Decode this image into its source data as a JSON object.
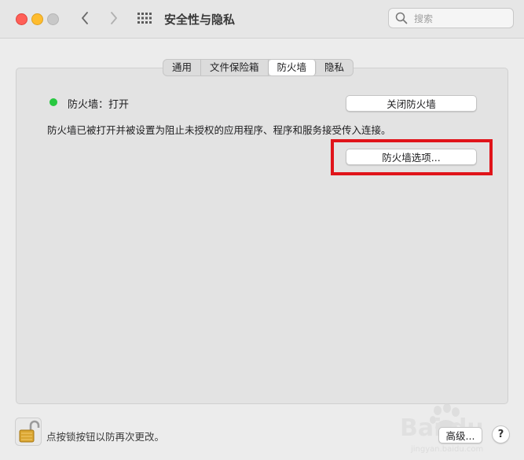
{
  "window": {
    "title": "安全性与隐私"
  },
  "search": {
    "placeholder": "搜索",
    "value": ""
  },
  "tabs": [
    {
      "label": "通用",
      "selected": false
    },
    {
      "label": "文件保险箱",
      "selected": false
    },
    {
      "label": "防火墙",
      "selected": true
    },
    {
      "label": "隐私",
      "selected": false
    }
  ],
  "firewall": {
    "status_label": "防火墙：打开",
    "status_color": "#28c840",
    "toggle_button_label": "关闭防火墙",
    "description": "防火墙已被打开并被设置为阻止未授权的应用程序、程序和服务接受传入连接。",
    "options_button_label": "防火墙选项..."
  },
  "footer": {
    "lock_text": "点按锁按钮以防再次更改。",
    "advanced_button_label": "高级...",
    "help_label": "?"
  },
  "highlight": {
    "color": "#e0141a"
  },
  "watermark": {
    "text": "Bai du 经验",
    "subtext": "jingyan.baidu.com"
  },
  "icons": {
    "close": "close-dot",
    "minimize": "minimize-dot",
    "maximize": "maximize-dot",
    "back": "chevron-left-icon",
    "forward": "chevron-right-icon",
    "grid": "grid-icon",
    "search": "search-icon",
    "lock": "lock-icon"
  }
}
